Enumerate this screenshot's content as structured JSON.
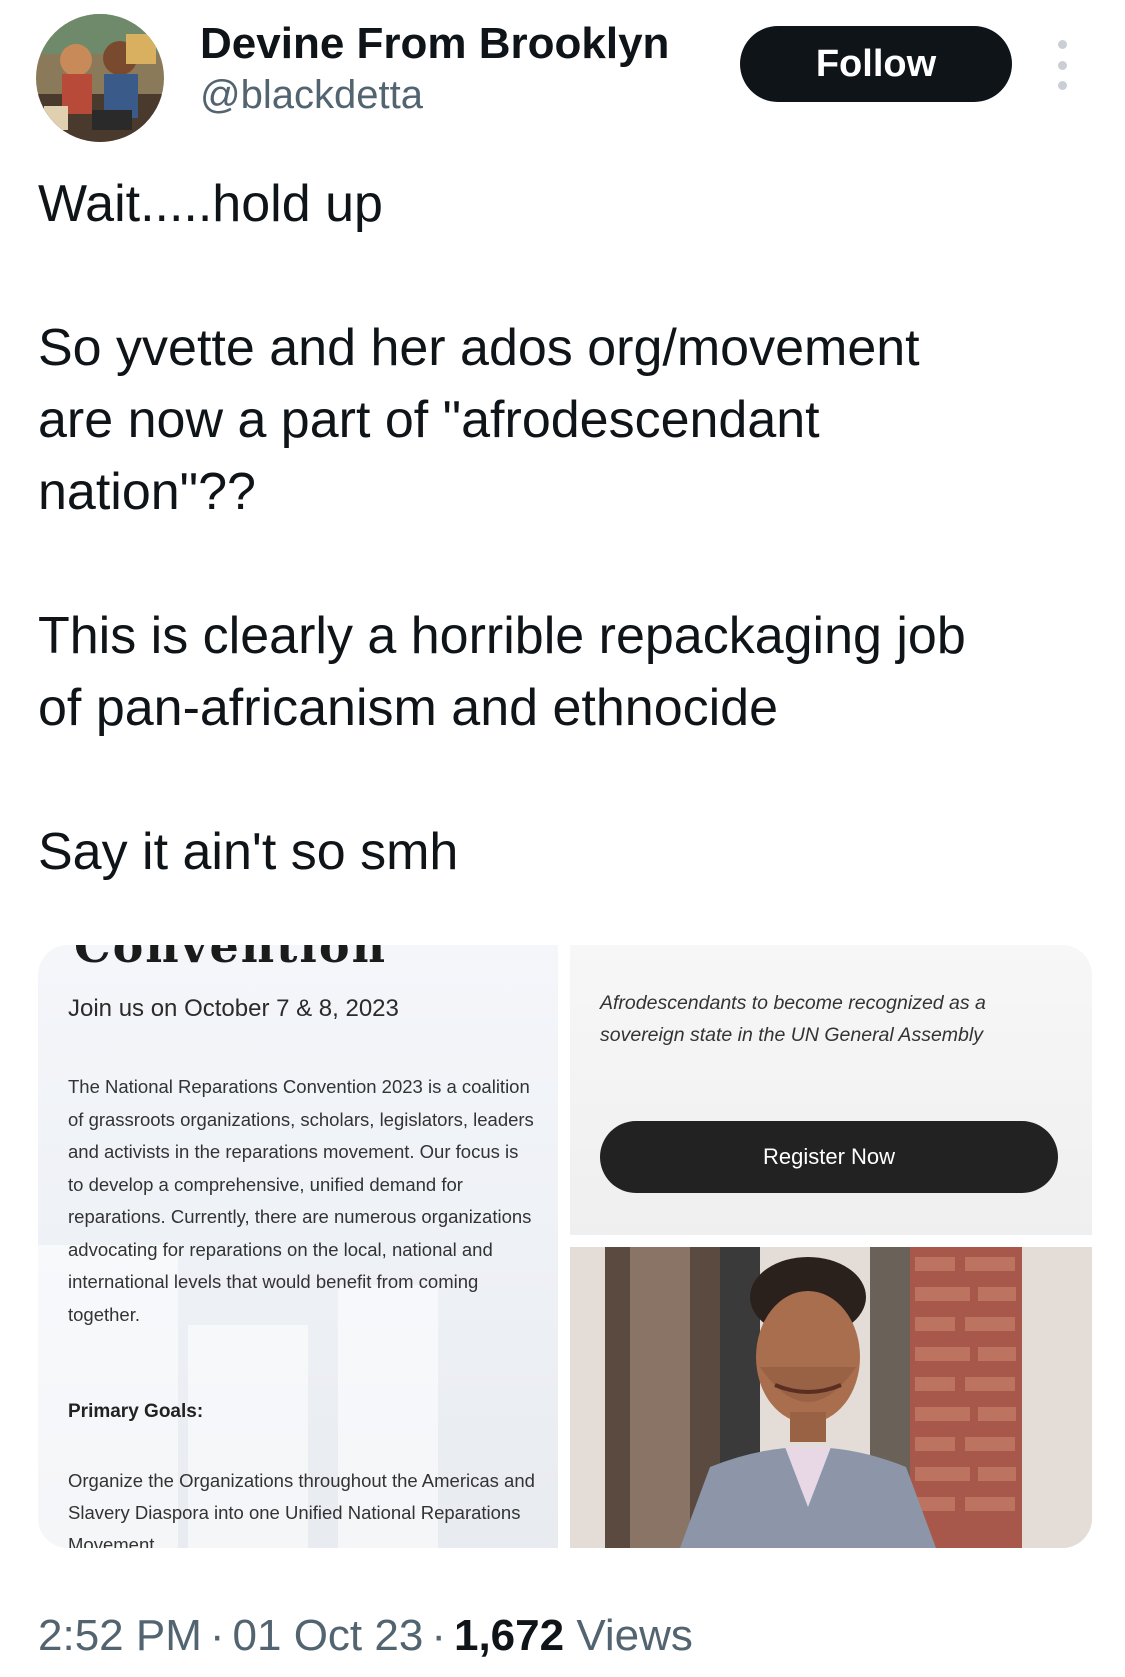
{
  "author": {
    "display_name": "Devine From Brooklyn",
    "handle": "@blackdetta",
    "avatar_icon": "avatar-artwork"
  },
  "follow_label": "Follow",
  "tweet": {
    "lines": "Wait.....hold up\n\nSo yvette and her ados org/movement\nare now a part of \"afrodescendant\nnation\"??\n\nThis is clearly a horrible repackaging job\nof pan-africanism and ethnocide\n\nSay it ain't so smh"
  },
  "media": {
    "left": {
      "cut_title": "Convention",
      "date": "Join us on October 7 & 8, 2023",
      "description": "The National Reparations Convention 2023 is a coalition of grassroots organizations, scholars, legislators, leaders and activists in the reparations movement. Our focus is to develop a comprehensive, unified demand for reparations. Currently, there are numerous organizations advocating for reparations on the local, national and international levels that would benefit from coming together.",
      "goals_heading": "Primary Goals:",
      "goal_1": "Organize the Organizations throughout the Americas and Slavery Diaspora into one Unified National Reparations Movement."
    },
    "right_top": {
      "text": "Afrodescendants to become recognized as a sovereign state in the UN General Assembly",
      "button_label": "Register Now"
    },
    "right_bottom": {
      "photo_icon": "person-photo"
    }
  },
  "meta": {
    "time": "2:52 PM",
    "date": "01 Oct 23",
    "views_count": "1,672",
    "views_label": "Views"
  },
  "colors": {
    "text": "#0f1419",
    "secondary": "#536471",
    "button": "#0f1419"
  }
}
